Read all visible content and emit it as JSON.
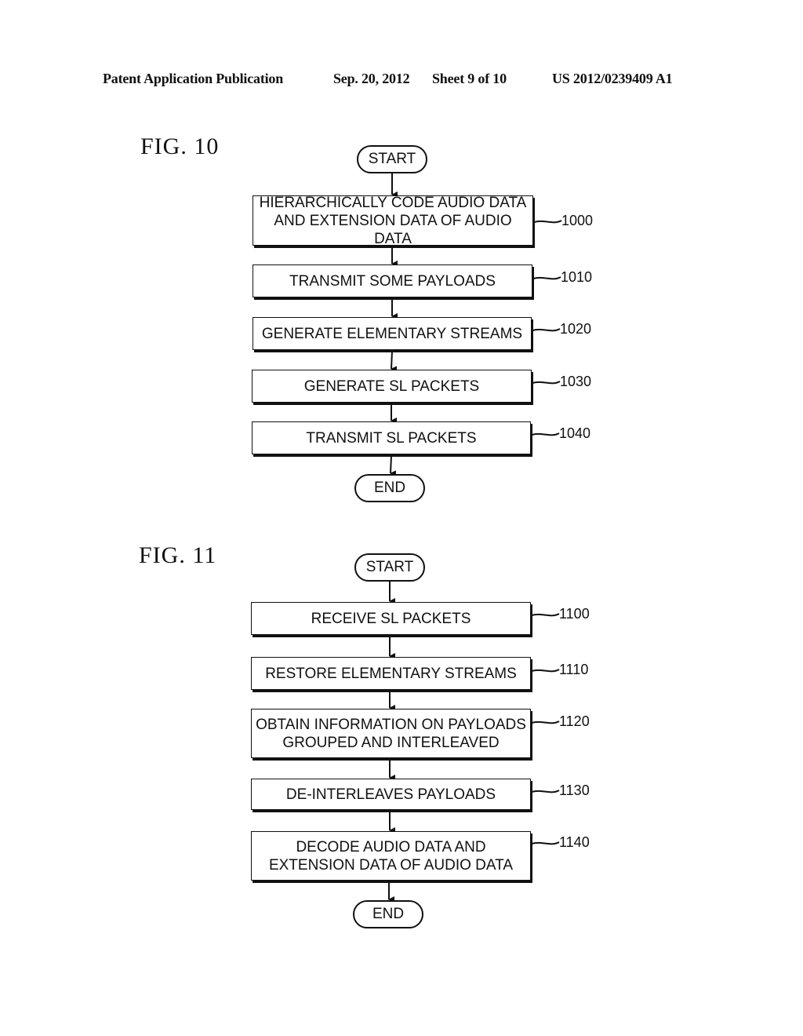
{
  "header": {
    "left": "Patent Application Publication",
    "date": "Sep. 20, 2012",
    "sheet": "Sheet 9 of 10",
    "number": "US 2012/0239409 A1"
  },
  "fig10": {
    "label": "FIG. 10",
    "start": "START",
    "end": "END",
    "steps": [
      {
        "lines": [
          "HIERARCHICALLY CODE AUDIO DATA",
          "AND EXTENSION DATA OF AUDIO DATA"
        ],
        "ref": "1000"
      },
      {
        "lines": [
          "TRANSMIT SOME PAYLOADS"
        ],
        "ref": "1010"
      },
      {
        "lines": [
          "GENERATE ELEMENTARY STREAMS"
        ],
        "ref": "1020"
      },
      {
        "lines": [
          "GENERATE SL PACKETS"
        ],
        "ref": "1030"
      },
      {
        "lines": [
          "TRANSMIT SL PACKETS"
        ],
        "ref": "1040"
      }
    ]
  },
  "fig11": {
    "label": "FIG. 11",
    "start": "START",
    "end": "END",
    "steps": [
      {
        "lines": [
          "RECEIVE SL PACKETS"
        ],
        "ref": "1100"
      },
      {
        "lines": [
          "RESTORE ELEMENTARY STREAMS"
        ],
        "ref": "1110"
      },
      {
        "lines": [
          "OBTAIN INFORMATION ON PAYLOADS",
          "GROUPED AND INTERLEAVED"
        ],
        "ref": "1120"
      },
      {
        "lines": [
          "DE-INTERLEAVES PAYLOADS"
        ],
        "ref": "1130"
      },
      {
        "lines": [
          "DECODE AUDIO DATA AND",
          "EXTENSION DATA OF AUDIO DATA"
        ],
        "ref": "1140"
      }
    ]
  }
}
